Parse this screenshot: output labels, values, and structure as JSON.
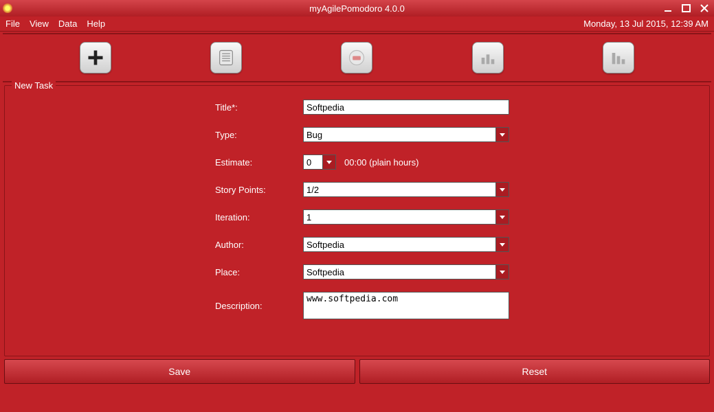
{
  "window": {
    "title": "myAgilePomodoro 4.0.0"
  },
  "menubar": {
    "file": "File",
    "view": "View",
    "data": "Data",
    "help": "Help",
    "datetime": "Monday, 13 Jul 2015, 12:39 AM"
  },
  "fieldset": {
    "legend": "New Task"
  },
  "form": {
    "title_label": "Title*:",
    "title_value": "Softpedia",
    "type_label": "Type:",
    "type_value": "Bug",
    "estimate_label": "Estimate:",
    "estimate_value": "0",
    "estimate_hint": "00:00 (plain hours)",
    "storypoints_label": "Story Points:",
    "storypoints_value": "1/2",
    "iteration_label": "Iteration:",
    "iteration_value": "1",
    "author_label": "Author:",
    "author_value": "Softpedia",
    "place_label": "Place:",
    "place_value": "Softpedia",
    "description_label": "Description:",
    "description_value": "www.softpedia.com"
  },
  "buttons": {
    "save": "Save",
    "reset": "Reset"
  }
}
